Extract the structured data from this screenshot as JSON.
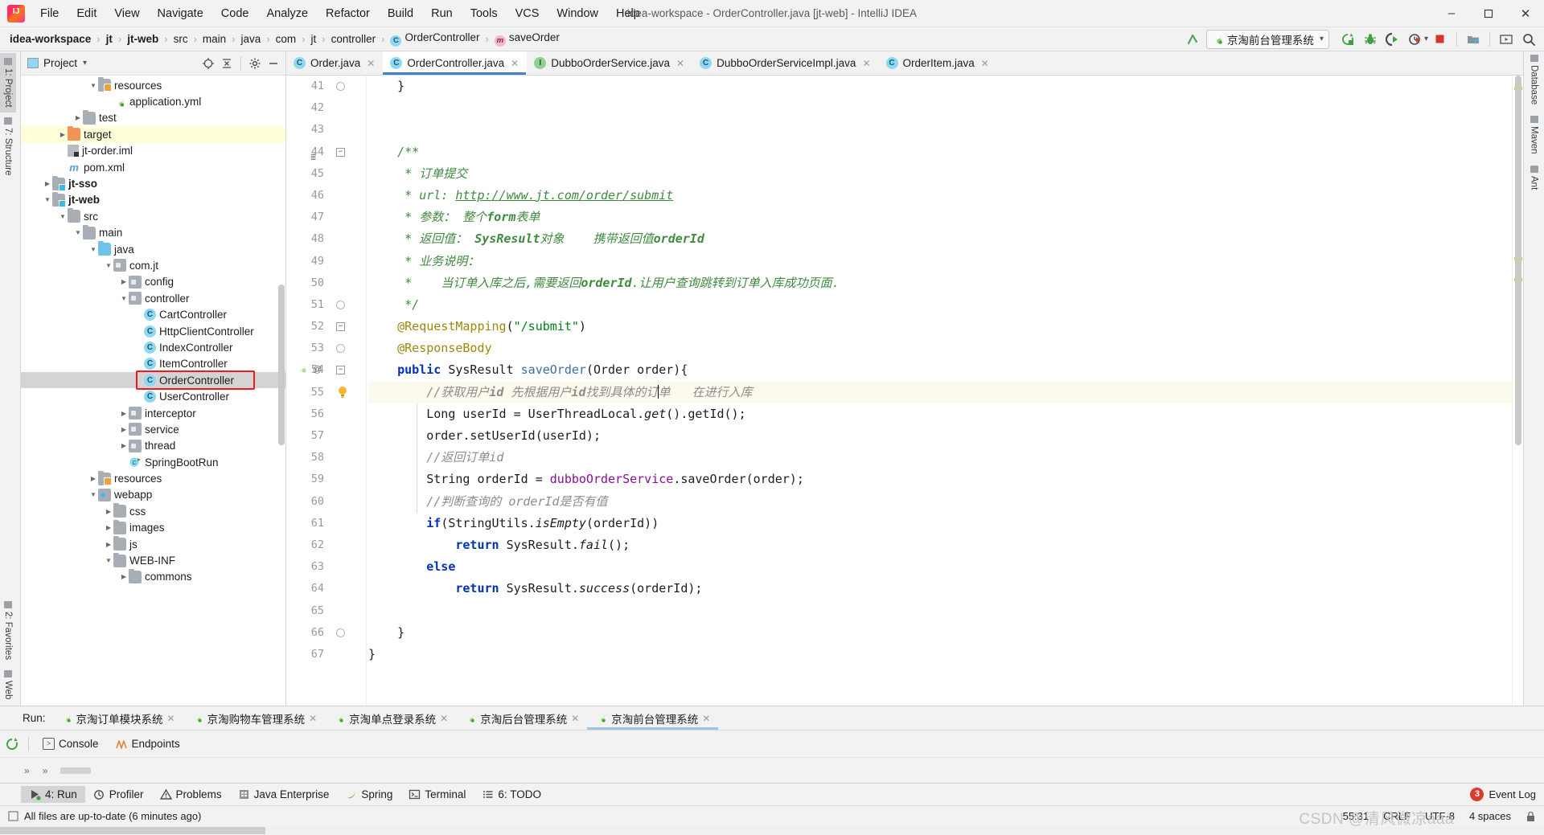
{
  "window": {
    "title": "idea-workspace - OrderController.java [jt-web] - IntelliJ IDEA",
    "minimize": "–",
    "maximize": "❐",
    "close": "✕"
  },
  "menubar": [
    {
      "label": "File"
    },
    {
      "label": "Edit"
    },
    {
      "label": "View"
    },
    {
      "label": "Navigate"
    },
    {
      "label": "Code"
    },
    {
      "label": "Analyze"
    },
    {
      "label": "Refactor"
    },
    {
      "label": "Build"
    },
    {
      "label": "Run"
    },
    {
      "label": "Tools"
    },
    {
      "label": "VCS"
    },
    {
      "label": "Window"
    },
    {
      "label": "Help"
    }
  ],
  "breadcrumb": [
    {
      "label": "idea-workspace",
      "bold": true
    },
    {
      "label": "jt",
      "bold": true
    },
    {
      "label": "jt-web",
      "bold": true
    },
    {
      "label": "src",
      "bold": false
    },
    {
      "label": "main",
      "bold": false
    },
    {
      "label": "java",
      "bold": false
    },
    {
      "label": "com",
      "bold": false
    },
    {
      "label": "jt",
      "bold": false
    },
    {
      "label": "controller",
      "bold": false
    },
    {
      "label": "OrderController",
      "bold": false,
      "icon": "class-icon"
    },
    {
      "label": "saveOrder",
      "bold": false,
      "icon": "method-icon"
    }
  ],
  "toolbar": {
    "run_config": "京淘前台管理系统",
    "dropdown_caret": "▾",
    "icons": [
      "update-app-icon",
      "debug-icon",
      "run-with-coverage-icon",
      "profiler-icon",
      "stop-icon",
      "project-structure-icon",
      "presentation-icon",
      "search-everywhere-icon"
    ]
  },
  "left_toolwindows": [
    {
      "label": "1: Project",
      "active": true
    },
    {
      "label": "7: Structure",
      "active": false
    },
    {
      "label": "2: Favorites",
      "active": false
    },
    {
      "label": "Web",
      "active": false
    }
  ],
  "right_toolwindows": [
    {
      "label": "Database"
    },
    {
      "label": "Maven"
    },
    {
      "label": "Ant"
    }
  ],
  "project_panel": {
    "title": "Project",
    "caret": "▾",
    "actions": [
      "locate-icon",
      "collapse-all-icon",
      "settings-icon",
      "hide-icon"
    ],
    "tree": [
      {
        "depth": 4,
        "label": "resources",
        "icon": "folder-resources",
        "arrow": "down",
        "state": "normal"
      },
      {
        "depth": 5,
        "label": "application.yml",
        "icon": "yml",
        "arrow": "none",
        "state": "normal"
      },
      {
        "depth": 3,
        "label": "test",
        "icon": "folder",
        "arrow": "right",
        "state": "normal"
      },
      {
        "depth": 2,
        "label": "target",
        "icon": "folder-orange",
        "arrow": "right",
        "state": "highlight"
      },
      {
        "depth": 2,
        "label": "jt-order.iml",
        "icon": "iml",
        "arrow": "none",
        "state": "normal"
      },
      {
        "depth": 2,
        "label": "pom.xml",
        "icon": "maven-m",
        "arrow": "none",
        "state": "normal"
      },
      {
        "depth": 1,
        "label": "jt-sso",
        "icon": "folder-module",
        "arrow": "right",
        "bold": true,
        "state": "normal"
      },
      {
        "depth": 1,
        "label": "jt-web",
        "icon": "folder-module",
        "arrow": "down",
        "bold": true,
        "state": "normal"
      },
      {
        "depth": 2,
        "label": "src",
        "icon": "folder",
        "arrow": "down",
        "state": "normal"
      },
      {
        "depth": 3,
        "label": "main",
        "icon": "folder",
        "arrow": "down",
        "state": "normal"
      },
      {
        "depth": 4,
        "label": "java",
        "icon": "folder-blue",
        "arrow": "down",
        "state": "normal"
      },
      {
        "depth": 5,
        "label": "com.jt",
        "icon": "package",
        "arrow": "down",
        "state": "normal"
      },
      {
        "depth": 6,
        "label": "config",
        "icon": "package",
        "arrow": "right",
        "state": "normal"
      },
      {
        "depth": 6,
        "label": "controller",
        "icon": "package",
        "arrow": "down",
        "state": "normal"
      },
      {
        "depth": 7,
        "label": "CartController",
        "icon": "class",
        "arrow": "none",
        "state": "normal"
      },
      {
        "depth": 7,
        "label": "HttpClientController",
        "icon": "class",
        "arrow": "none",
        "state": "normal"
      },
      {
        "depth": 7,
        "label": "IndexController",
        "icon": "class",
        "arrow": "none",
        "state": "normal"
      },
      {
        "depth": 7,
        "label": "ItemController",
        "icon": "class",
        "arrow": "none",
        "state": "normal"
      },
      {
        "depth": 7,
        "label": "OrderController",
        "icon": "class",
        "arrow": "none",
        "state": "selected"
      },
      {
        "depth": 7,
        "label": "UserController",
        "icon": "class",
        "arrow": "none",
        "state": "normal"
      },
      {
        "depth": 6,
        "label": "interceptor",
        "icon": "package",
        "arrow": "right",
        "state": "normal"
      },
      {
        "depth": 6,
        "label": "service",
        "icon": "package",
        "arrow": "right",
        "state": "normal"
      },
      {
        "depth": 6,
        "label": "thread",
        "icon": "package",
        "arrow": "right",
        "state": "normal"
      },
      {
        "depth": 6,
        "label": "SpringBootRun",
        "icon": "spring-class",
        "arrow": "none",
        "state": "normal"
      },
      {
        "depth": 4,
        "label": "resources",
        "icon": "folder-resources",
        "arrow": "right",
        "state": "normal"
      },
      {
        "depth": 4,
        "label": "webapp",
        "icon": "package-web",
        "arrow": "down",
        "state": "normal"
      },
      {
        "depth": 5,
        "label": "css",
        "icon": "folder",
        "arrow": "right",
        "state": "normal"
      },
      {
        "depth": 5,
        "label": "images",
        "icon": "folder",
        "arrow": "right",
        "state": "normal"
      },
      {
        "depth": 5,
        "label": "js",
        "icon": "folder",
        "arrow": "right",
        "state": "normal"
      },
      {
        "depth": 5,
        "label": "WEB-INF",
        "icon": "folder",
        "arrow": "down",
        "state": "normal"
      },
      {
        "depth": 6,
        "label": "commons",
        "icon": "folder",
        "arrow": "right",
        "state": "normal"
      }
    ]
  },
  "editor_tabs": [
    {
      "label": "Order.java",
      "icon": "class",
      "active": false,
      "close": "✕"
    },
    {
      "label": "OrderController.java",
      "icon": "class",
      "active": true,
      "close": "✕"
    },
    {
      "label": "DubboOrderService.java",
      "icon": "interface",
      "active": false,
      "close": "✕"
    },
    {
      "label": "DubboOrderServiceImpl.java",
      "icon": "class",
      "active": false,
      "close": "✕"
    },
    {
      "label": "OrderItem.java",
      "icon": "class",
      "active": false,
      "close": "✕"
    }
  ],
  "code": {
    "first_line": 41,
    "lines": [
      {
        "n": 41,
        "fold": "end",
        "html": "    }"
      },
      {
        "n": 42,
        "html": ""
      },
      {
        "n": 43,
        "html": ""
      },
      {
        "n": 44,
        "fold": "start",
        "marks": "≣",
        "html": "    <span class=\"jdoc\">/**</span>"
      },
      {
        "n": 45,
        "html": "     <span class=\"jdoc\">* 订单提交</span>"
      },
      {
        "n": 46,
        "html": "     <span class=\"jdoc\">* url: </span><span class=\"jdoc-link\">http://www.jt.com/order/submit</span>"
      },
      {
        "n": 47,
        "html": "     <span class=\"jdoc\">* 参数： 整个</span><span class=\"jdoc-b\">form</span><span class=\"jdoc\">表单</span>"
      },
      {
        "n": 48,
        "html": "     <span class=\"jdoc\">* 返回值： </span><span class=\"jdoc-b\">SysResult</span><span class=\"jdoc\">对象    携带返回值</span><span class=\"jdoc-b\">orderId</span>"
      },
      {
        "n": 49,
        "html": "     <span class=\"jdoc\">* 业务说明：</span>"
      },
      {
        "n": 50,
        "html": "     <span class=\"jdoc\">*    当订单入库之后,需要返回</span><span class=\"jdoc-b\">orderId</span><span class=\"jdoc\">.让用户查询跳转到订单入库成功页面.</span>"
      },
      {
        "n": 51,
        "fold": "end",
        "html": "     <span class=\"jdoc\">*/</span>"
      },
      {
        "n": 52,
        "fold": "start",
        "html": "    <span class=\"ann\">@RequestMapping</span>(<span class=\"str\">\"/submit\"</span>)"
      },
      {
        "n": 53,
        "fold": "end",
        "html": "    <span class=\"ann\">@ResponseBody</span>"
      },
      {
        "n": 54,
        "fold": "start",
        "marks": "spring-at",
        "html": "    <span class=\"kw\">public</span> SysResult <span class=\"mname\">saveOrder</span>(Order order){"
      },
      {
        "n": 55,
        "bulb": true,
        "hl": true,
        "html": "        <span class=\"cmt ital\">//获取用户<b>id</b> 先根据用户<b>id</b>找到具体的订</span><span class=\"caret\"></span><span class=\"cmt ital\">单   在进行入库</span>"
      },
      {
        "n": 56,
        "html": "        Long userId = UserThreadLocal.<span class=\"ital\">get</span>().getId();"
      },
      {
        "n": 57,
        "html": "        order.setUserId(userId);"
      },
      {
        "n": 58,
        "html": "        <span class=\"cmt ital\">//返回订单id</span>"
      },
      {
        "n": 59,
        "html": "        String orderId = <span class=\"fld\">dubboOrderService</span>.saveOrder(order);"
      },
      {
        "n": 60,
        "html": "        <span class=\"cmt ital\">//判断查询的 orderId是否有值</span>"
      },
      {
        "n": 61,
        "html": "        <span class=\"kw\">if</span>(StringUtils.<span class=\"ital\">isEmpty</span>(orderId))"
      },
      {
        "n": 62,
        "html": "            <span class=\"kw\">return</span> SysResult.<span class=\"ital\">fail</span>();"
      },
      {
        "n": 63,
        "html": "        <span class=\"kw\">else</span>"
      },
      {
        "n": 64,
        "html": "            <span class=\"kw\">return</span> SysResult.<span class=\"ital\">success</span>(orderId);"
      },
      {
        "n": 65,
        "html": ""
      },
      {
        "n": 66,
        "fold": "end",
        "html": "    }"
      },
      {
        "n": 67,
        "html": "}"
      }
    ]
  },
  "run_panel": {
    "label": "Run:",
    "tabs": [
      {
        "label": "京淘订单模块系统",
        "active": false,
        "close": "✕"
      },
      {
        "label": "京淘购物车管理系统",
        "active": false,
        "close": "✕"
      },
      {
        "label": "京淘单点登录系统",
        "active": false,
        "close": "✕"
      },
      {
        "label": "京淘后台管理系统",
        "active": false,
        "close": "✕"
      },
      {
        "label": "京淘前台管理系统",
        "active": true,
        "close": "✕"
      }
    ],
    "subtabs": [
      {
        "label": "Console",
        "icon": "console-icon"
      },
      {
        "label": "Endpoints",
        "icon": "endpoints-icon"
      }
    ],
    "rerun_icon": "rerun-icon",
    "expand_chevron": "»"
  },
  "bottom_toolbar": {
    "items": [
      {
        "label": "4: Run",
        "underline": "4",
        "icon": "run-icon",
        "active": true
      },
      {
        "label": "Profiler",
        "icon": "profiler-icon",
        "active": false
      },
      {
        "label": "Problems",
        "icon": "problems-icon",
        "active": false
      },
      {
        "label": "Java Enterprise",
        "icon": "java-enterprise-icon",
        "active": false
      },
      {
        "label": "Spring",
        "icon": "spring-icon",
        "active": false
      },
      {
        "label": "Terminal",
        "icon": "terminal-icon",
        "active": false
      },
      {
        "label": "6: TODO",
        "underline": "6",
        "icon": "todo-icon",
        "active": false
      }
    ],
    "event_log": "Event Log",
    "event_count": "3"
  },
  "statusbar": {
    "message": "All files are up-to-date (6 minutes ago)",
    "caret_position": "55:31",
    "line_separator": "CRLF",
    "encoding": "UTF-8",
    "indent": "4 spaces",
    "lock_icon": "lock-icon"
  },
  "watermark": "CSDN @清风微凉aaa",
  "colors": {
    "accent": "#4083c9",
    "selection": "#d4d4d4",
    "highlight_row": "#ffffd8",
    "red_box": "#ef1a1a",
    "comment_green": "#3f8a3f",
    "keyword_blue": "#0033b3",
    "annotation_gold": "#9e880d",
    "string_green": "#067d17",
    "field_purple": "#871094"
  }
}
